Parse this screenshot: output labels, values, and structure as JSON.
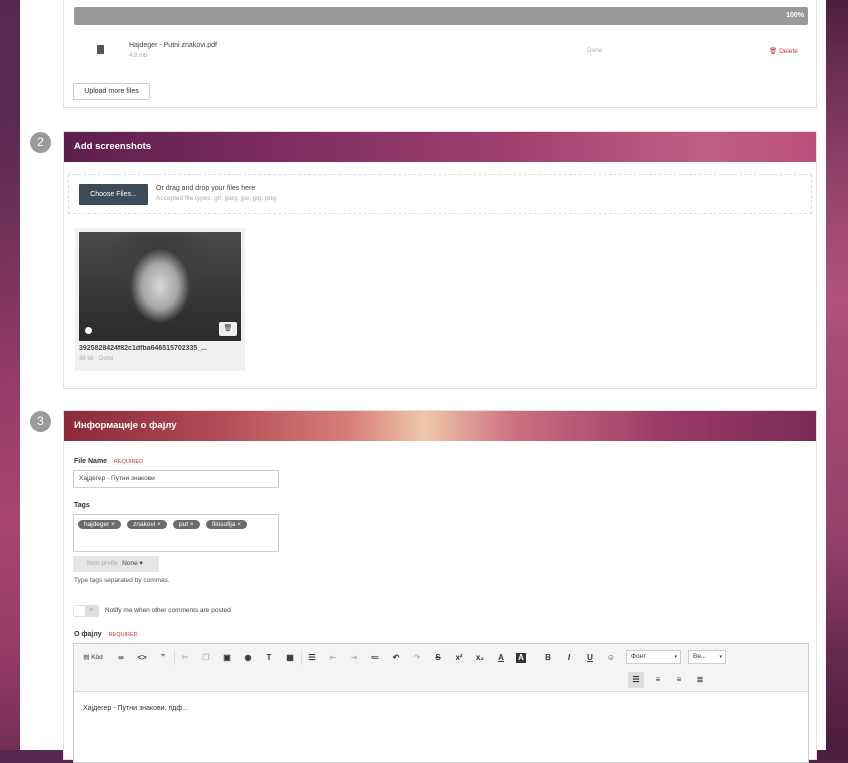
{
  "upload": {
    "progress_label": "100%",
    "progress": 1.0,
    "file_name": "Hajdeger - Putni znakovi.pdf",
    "file_size": "4.8 mb",
    "file_status": "Done",
    "delete_label": "Delete",
    "upload_more_label": "Upload more files"
  },
  "screenshots": {
    "step": "2",
    "title": "Add screenshots",
    "choose_label": "Choose Files...",
    "drop_text": "Or drag and drop your files here",
    "accepted_text": "Accepted file types: gif, jpeg, jpe, jpg, png",
    "thumb_name": "3925828424f82c1dfba646515702335_...",
    "thumb_meta": "36 kb - Done"
  },
  "info": {
    "step": "3",
    "title": "Информације о фајлу",
    "file_name_label": "File Name",
    "required": "REQUIRED",
    "file_name_value": "Хајдегер - Путни знакови",
    "tags_label": "Tags",
    "tags": [
      "hajdeger",
      "znakovi",
      "put",
      "filosofija"
    ],
    "item_prefix_label": "Item prefix",
    "item_prefix_value": "None",
    "tags_hint": "Type tags separated by commas.",
    "notify_label": "Notify me when other comments are posted",
    "about_label": "О фајлу",
    "editor": {
      "code_label": "Kôd",
      "font_label": "Фонт",
      "size_label": "Ве...",
      "content": "Хајдегер - Путни знакови. пдф..."
    }
  }
}
